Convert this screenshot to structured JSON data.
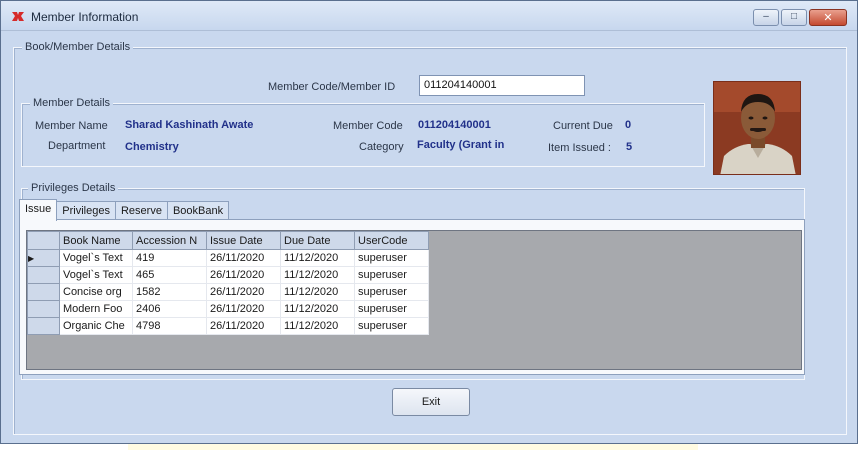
{
  "window": {
    "title": "Member Information",
    "controls": {
      "minimize": "–",
      "maximize": "□",
      "close": "✕"
    }
  },
  "book_member": {
    "legend": "Book/Member Details",
    "code_label": "Member Code/Member ID",
    "code_value": "011204140001"
  },
  "member_details": {
    "legend": "Member Details",
    "name_label": "Member Name",
    "name_value": "Sharad Kashinath Awate",
    "dept_label": "Department",
    "dept_value": "Chemistry",
    "code_label": "Member Code",
    "code_value": "011204140001",
    "category_label": "Category",
    "category_value": "Faculty (Grant in",
    "due_label": "Current Due",
    "due_value": "0",
    "issued_label": "Item Issued :",
    "issued_value": "5"
  },
  "privileges": {
    "legend": "Privileges Details",
    "tabs": [
      "Issue",
      "Privileges",
      "Reserve",
      "BookBank"
    ],
    "active_tab": "Issue"
  },
  "grid": {
    "columns": [
      "Book Name",
      "Accession N",
      "Issue Date",
      "Due Date",
      "UserCode"
    ],
    "rows": [
      [
        "Vogel`s Text",
        "419",
        "26/11/2020",
        "11/12/2020",
        "superuser"
      ],
      [
        "Vogel`s Text",
        "465",
        "26/11/2020",
        "11/12/2020",
        "superuser"
      ],
      [
        "Concise org",
        "1582",
        "26/11/2020",
        "11/12/2020",
        "superuser"
      ],
      [
        "Modern Foo",
        "2406",
        "26/11/2020",
        "11/12/2020",
        "superuser"
      ],
      [
        "Organic Che",
        "4798",
        "26/11/2020",
        "11/12/2020",
        "superuser"
      ]
    ],
    "current_row_marker": "▶"
  },
  "actions": {
    "exit_label": "Exit"
  },
  "colors": {
    "form_background": "#c9d8ee",
    "value_text": "#21318a",
    "grid_background": "#a7a9ad"
  }
}
